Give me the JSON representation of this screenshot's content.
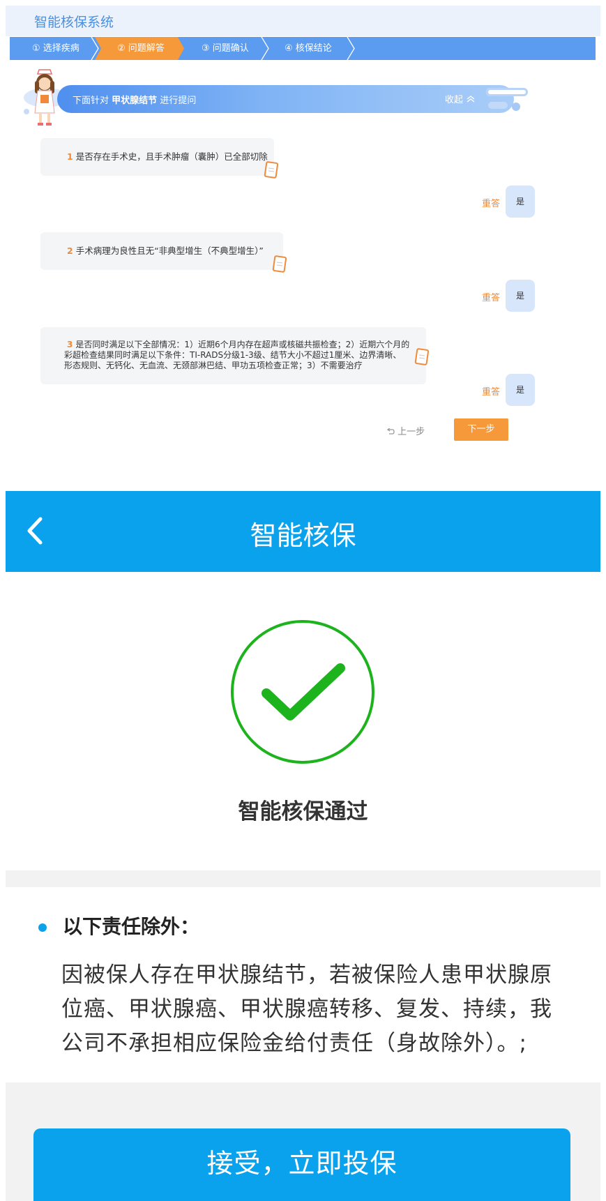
{
  "system": {
    "title": "智能核保系统",
    "steps": [
      {
        "label": "① 选择疾病"
      },
      {
        "label": "② 问题解答"
      },
      {
        "label": "③ 问题确认"
      },
      {
        "label": "④ 核保结论"
      }
    ],
    "banner": {
      "prefix": "下面针对",
      "subject": "甲状腺结节",
      "suffix": "进行提问",
      "collapse": "收起"
    },
    "questions": [
      {
        "num": "1",
        "text": "是否存在手术史，且手术肿瘤（囊肿）已全部切除",
        "answer": "是",
        "redo": "重答"
      },
      {
        "num": "2",
        "text": "手术病理为良性且无“非典型增生（不典型增生）”",
        "answer": "是",
        "redo": "重答"
      },
      {
        "num": "3",
        "line1": "是否同时满足以下全部情况：1）近期6个月内存在超声或核磁共振检查；2）近期六个月的",
        "line2": "彩超检查结果同时满足以下条件：TI-RADS分级1-3级、结节大小不超过1厘米、边界清晰、",
        "line3": "形态规则、无钙化、无血流、无颈部淋巴结、甲功五项检查正常；3）不需要治疗",
        "answer": "是",
        "redo": "重答"
      }
    ],
    "nav": {
      "prev": "上一步",
      "next": "下一步"
    },
    "colors": {
      "accent": "#5b9cf0",
      "active_step": "#f6993b"
    }
  },
  "mobile": {
    "header_title": "智能核保",
    "result": "智能核保通过",
    "exclusion_title": "以下责任除外：",
    "exclusion_lines": [
      "因被保人存在甲状腺结节，若被保险人患甲状腺原",
      "位癌、甲状腺癌、甲状腺癌转移、复发、持续，我",
      "公司不承担相应保险金给付责任（身故除外）。;"
    ],
    "accept_button": "接受，立即投保",
    "colors": {
      "primary": "#0aa2ec",
      "success": "#1db31d"
    }
  }
}
